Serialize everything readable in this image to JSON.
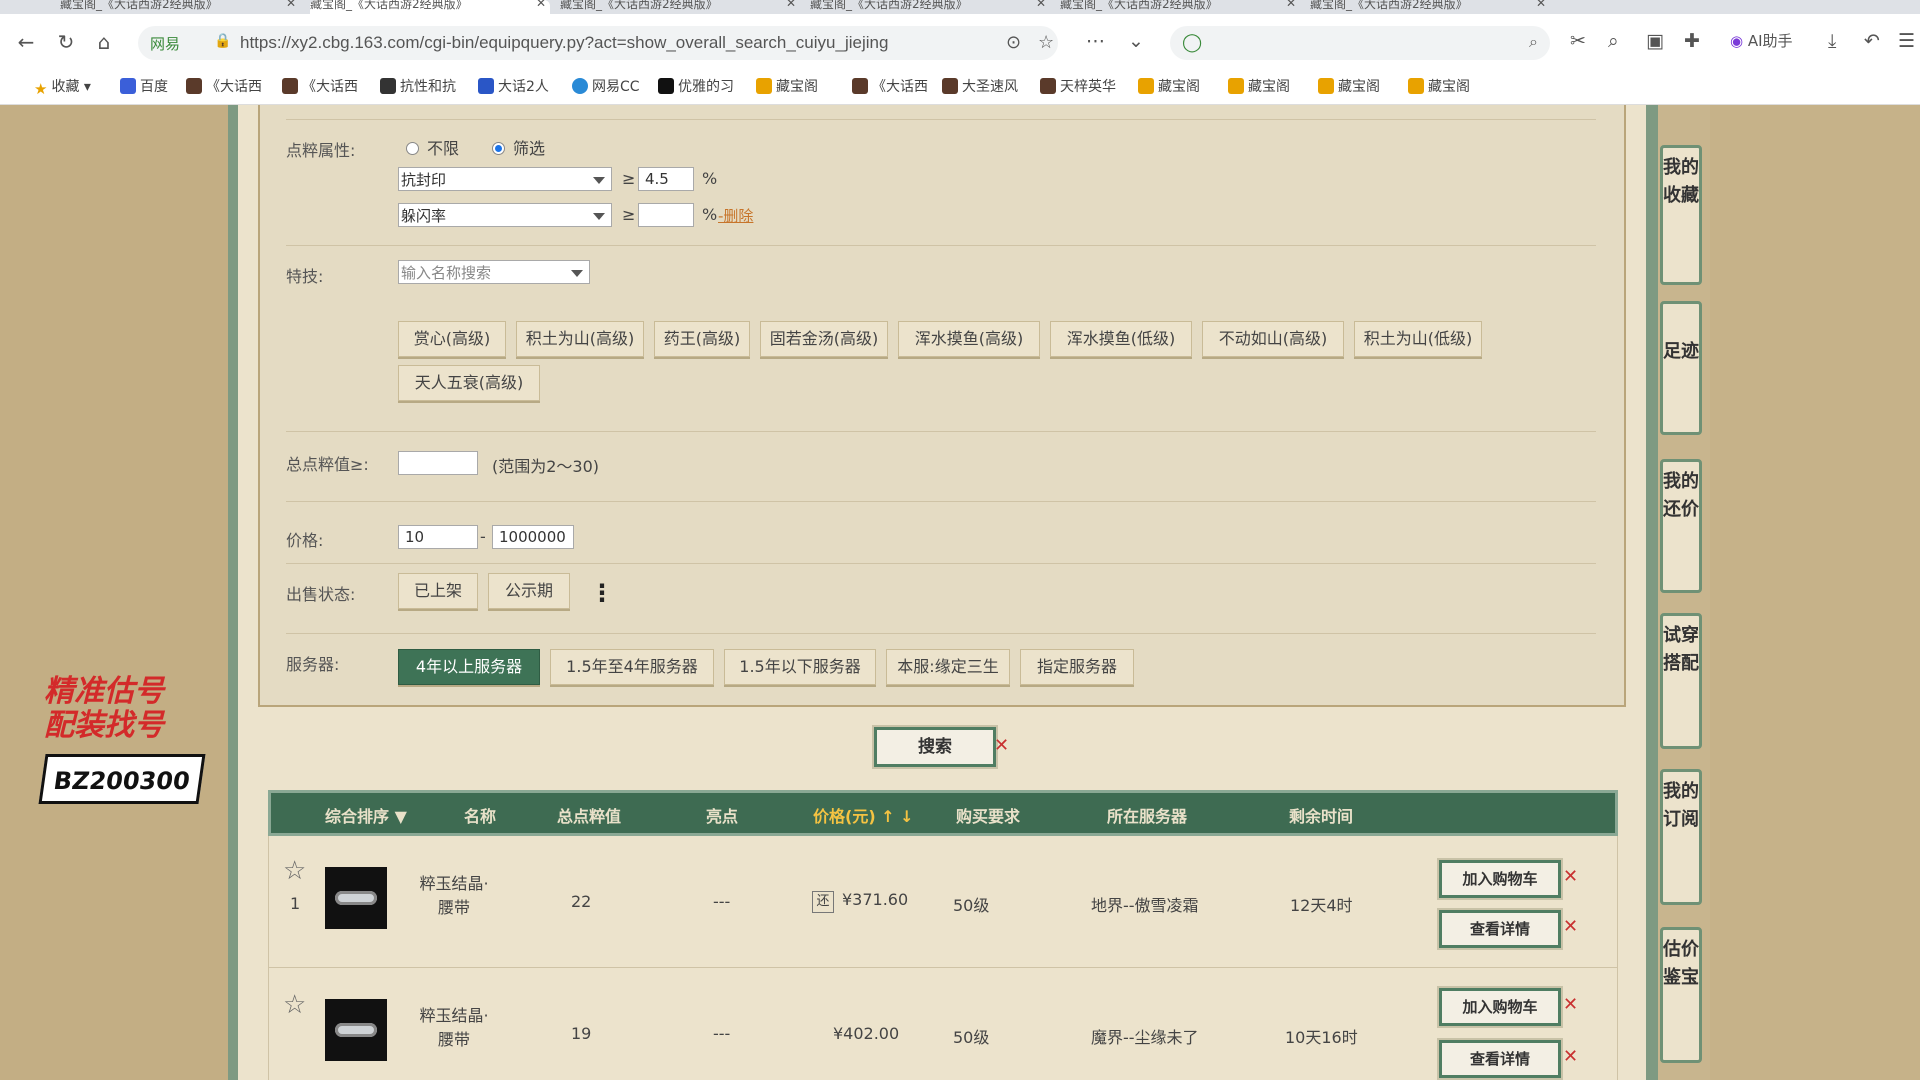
{
  "browser": {
    "tabs": [
      "藏宝阁_《大话西游2经典版》",
      "藏宝阁_《大话西游2经典版》",
      "藏宝阁_《大话西游2经典版》",
      "藏宝阁_《大话西游2经典版》",
      "藏宝阁_《大话西游2经典版》",
      "藏宝阁_《大话西游2经典版》"
    ],
    "site_label": "网易",
    "url": "https://xy2.cbg.163.com/cgi-bin/equipquery.py?act=show_overall_search_cuiyu_jiejing",
    "search_placeholder": "",
    "ai_label": "AI助手"
  },
  "bookmarks": [
    "收藏",
    "百度",
    "《大话西",
    "《大话西",
    "抗性和抗",
    "大话2人",
    "网易CC",
    "优雅的习",
    "藏宝阁",
    "《大话西",
    "大圣速风",
    "天梓英华",
    "藏宝阁",
    "藏宝阁",
    "藏宝阁",
    "藏宝阁"
  ],
  "filters": {
    "dianci_label": "点粹属性:",
    "radio_unlimited": "不限",
    "radio_filter": "筛选",
    "attr1": "抗封印",
    "attr1_op": "≥",
    "attr1_value": "4.5",
    "attr1_unit": "%",
    "attr2": "躲闪率",
    "attr2_op": "≥",
    "attr2_value": "",
    "attr2_unit": "%",
    "delete_label": "-删除",
    "skill_label": "特技:",
    "skill_placeholder": "输入名称搜索",
    "skills": [
      "赏心(高级)",
      "积土为山(高级)",
      "药王(高级)",
      "固若金汤(高级)",
      "浑水摸鱼(高级)",
      "浑水摸鱼(低级)",
      "不动如山(高级)",
      "积土为山(低级)",
      "天人五衰(高级)"
    ],
    "total_label": "总点粹值≥:",
    "total_value": "",
    "total_hint": "(范围为2～30)",
    "price_label": "价格:",
    "price_min": "10",
    "price_sep": "-",
    "price_max": "1000000",
    "status_label": "出售状态:",
    "status_options": [
      "已上架",
      "公示期"
    ],
    "status_more": "⋮",
    "server_label": "服务器:",
    "server_options": [
      "4年以上服务器",
      "1.5年至4年服务器",
      "1.5年以下服务器",
      "本服:缘定三生",
      "指定服务器"
    ],
    "search_button": "搜索"
  },
  "table": {
    "headers": [
      "综合排序 ▼",
      "名称",
      "总点粹值",
      "亮点",
      "价格(元) ↑ ↓",
      "购买要求",
      "所在服务器",
      "剩余时间"
    ],
    "rows": [
      {
        "index": "1",
        "name": "粹玉结晶·腰带",
        "total": "22",
        "highlight": "---",
        "repay_icon": "还",
        "price": "¥371.60",
        "req": "50级",
        "server": "地界--傲雪凌霜",
        "time": "12天4时",
        "add_cart": "加入购物车",
        "detail": "查看详情"
      },
      {
        "index": "",
        "name": "粹玉结晶·腰带",
        "total": "19",
        "highlight": "---",
        "repay_icon": "",
        "price": "¥402.00",
        "req": "50级",
        "server": "魔界--尘缘未了",
        "time": "10天16时",
        "add_cart": "加入购物车",
        "detail": "查看详情"
      }
    ]
  },
  "sidebar": [
    "我的收藏",
    "足迹",
    "我的还价",
    "试穿搭配",
    "我的订阅",
    "估价鉴宝"
  ],
  "promo": {
    "line1": "精准估号",
    "line2": "配装找号",
    "code": "BZ200300"
  },
  "colors": {
    "accent": "#3e7356",
    "header_text": "#e9e1c9",
    "highlight": "#f5c342",
    "delete_link": "#c7742a",
    "promo_red": "#d32a2a"
  }
}
